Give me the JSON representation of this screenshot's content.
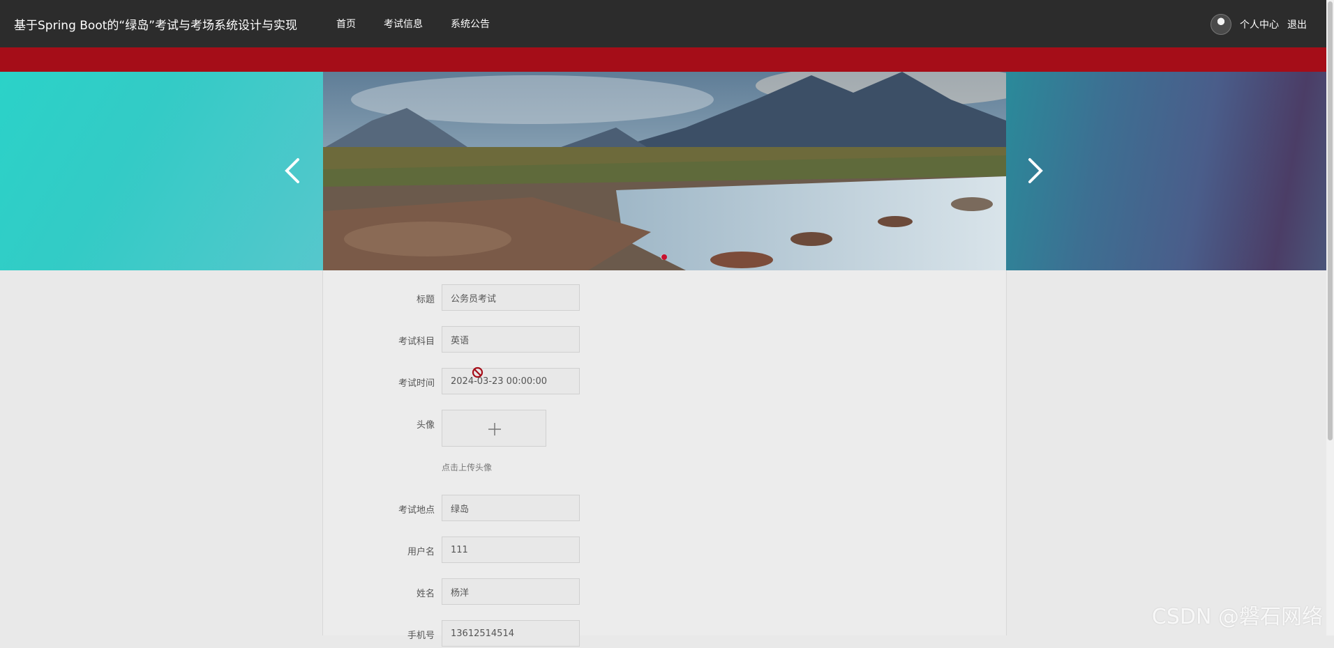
{
  "header": {
    "title": "基于Spring Boot的“绿岛”考试与考场系统设计与实现",
    "nav": [
      "首页",
      "考试信息",
      "系统公告"
    ],
    "profile_label": "个人中心",
    "logout_label": "退出"
  },
  "colors": {
    "topbar": "#2c2c2c",
    "accent_bar": "#a50d18",
    "page_bg": "#e9e9e9"
  },
  "banner": {
    "prev_icon": "chevron-left-icon",
    "next_icon": "chevron-right-icon",
    "indicator_count": 2,
    "active_indicator": 2
  },
  "form": {
    "fields": [
      {
        "label": "标题",
        "value": "公务员考试"
      },
      {
        "label": "考试科目",
        "value": "英语"
      },
      {
        "label": "考试时间",
        "value": "2024-03-23 00:00:00"
      }
    ],
    "avatar": {
      "label": "头像",
      "upload_icon": "plus-icon",
      "hint": "点击上传头像"
    },
    "fields2": [
      {
        "label": "考试地点",
        "value": "绿岛"
      },
      {
        "label": "用户名",
        "value": "111"
      },
      {
        "label": "姓名",
        "value": "杨洋"
      },
      {
        "label": "手机号",
        "value": "13612514514"
      }
    ]
  },
  "watermark": "CSDN @磐石网络"
}
